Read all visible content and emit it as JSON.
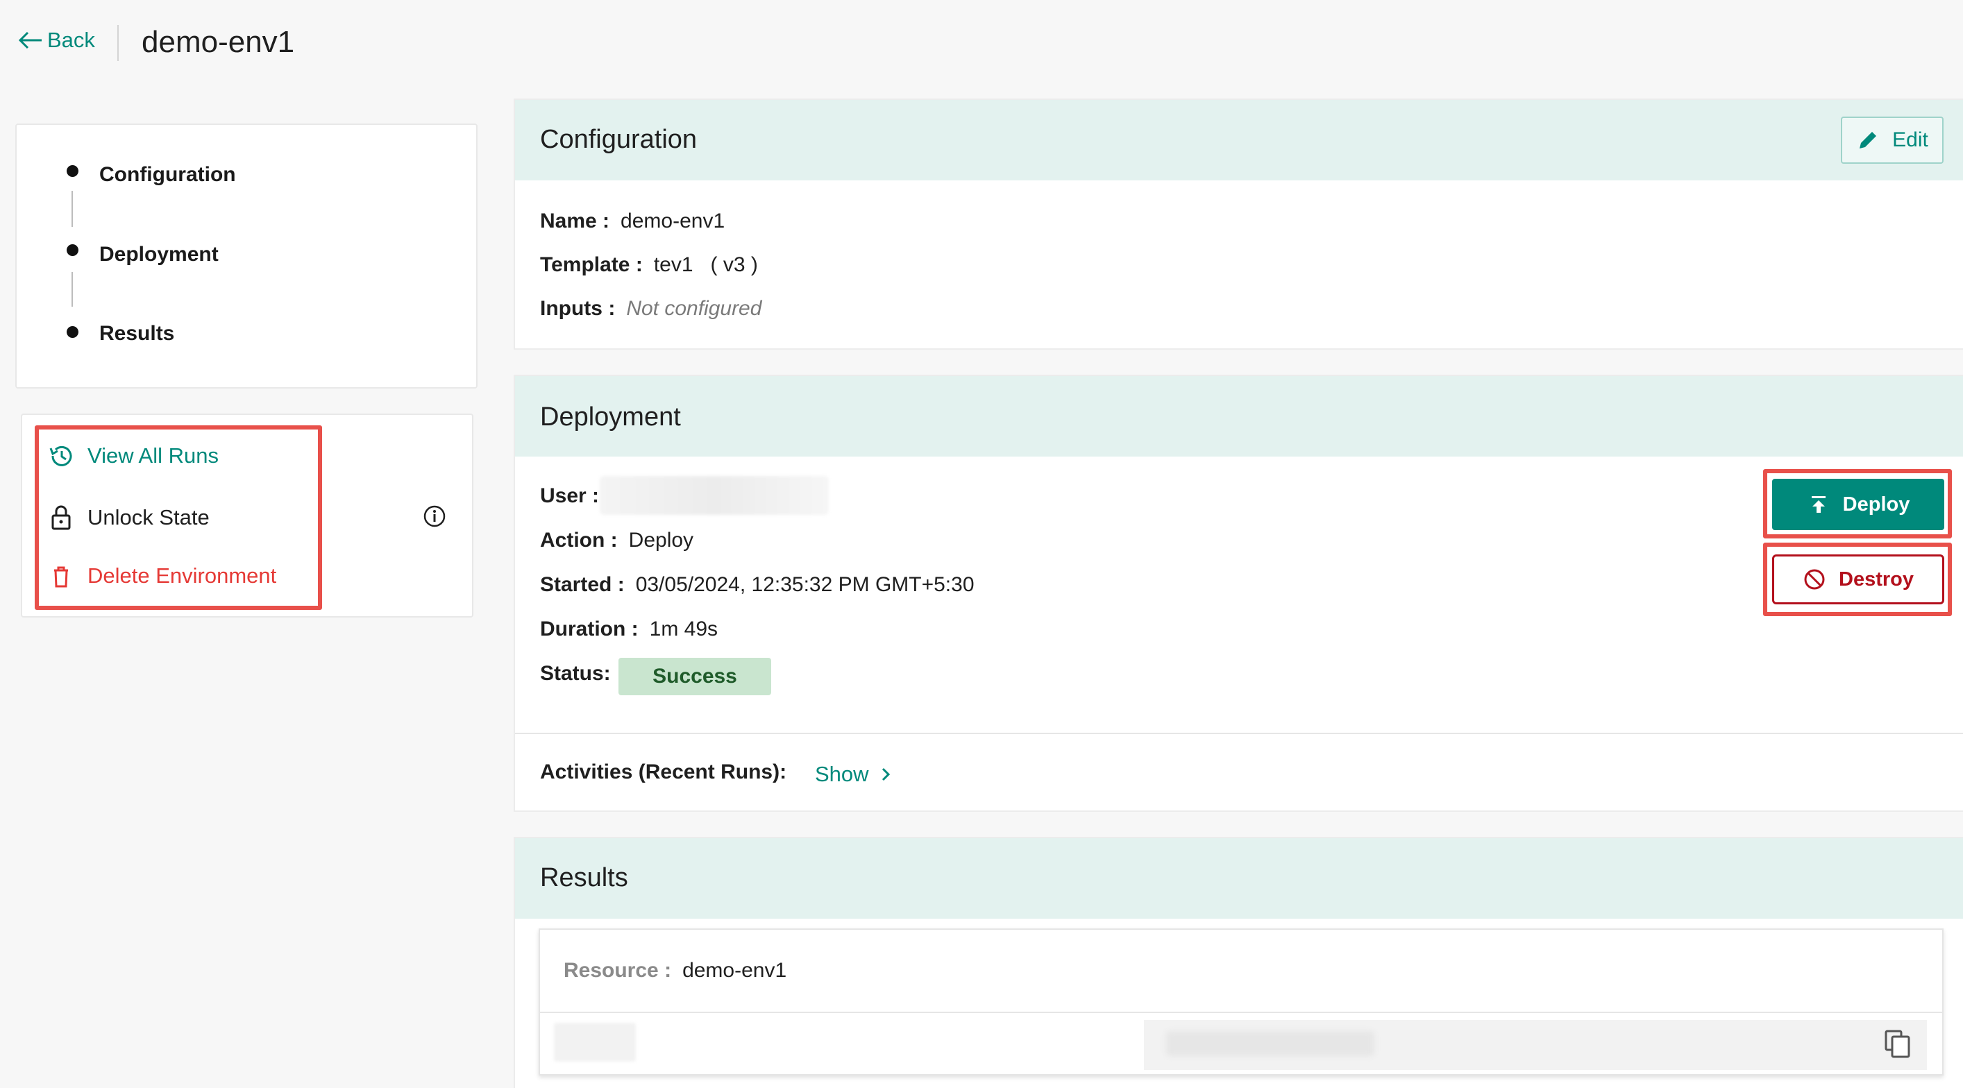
{
  "header": {
    "back_label": "Back",
    "title": "demo-env1"
  },
  "sidebar": {
    "nav_items": [
      {
        "label": "Configuration"
      },
      {
        "label": "Deployment"
      },
      {
        "label": "Results"
      }
    ],
    "actions": [
      {
        "label": "View All Runs",
        "color": "#00897b",
        "icon": "history-icon"
      },
      {
        "label": "Unlock State",
        "color": "#1f1f1f",
        "icon": "unlock-icon"
      },
      {
        "label": "Delete Environment",
        "color": "#e53935",
        "icon": "trash-icon"
      }
    ]
  },
  "configuration": {
    "title": "Configuration",
    "edit_label": "Edit",
    "name_key": "Name :",
    "name_value": "demo-env1",
    "template_key": "Template :",
    "template_value": "tev1   ( v3 )",
    "inputs_key": "Inputs :",
    "inputs_value": "Not configured"
  },
  "deployment": {
    "title": "Deployment",
    "user_key": "User :",
    "action_key": "Action :",
    "action_value": "Deploy",
    "started_key": "Started :",
    "started_value": "03/05/2024, 12:35:32 PM GMT+5:30",
    "duration_key": "Duration :",
    "duration_value": "1m 49s",
    "status_key": "Status:",
    "status_value": "Success",
    "deploy_label": "Deploy",
    "destroy_label": "Destroy",
    "activities_key": "Activities (Recent Runs):",
    "show_label": "Show"
  },
  "results": {
    "title": "Results",
    "resource_key": "Resource :",
    "resource_value": "demo-env1"
  },
  "colors": {
    "accent": "#00897b",
    "danger": "#b3101c",
    "highlight": "#e8504a",
    "section_header_bg": "#e3f2ef",
    "success_badge_bg": "#c9e5cf"
  }
}
